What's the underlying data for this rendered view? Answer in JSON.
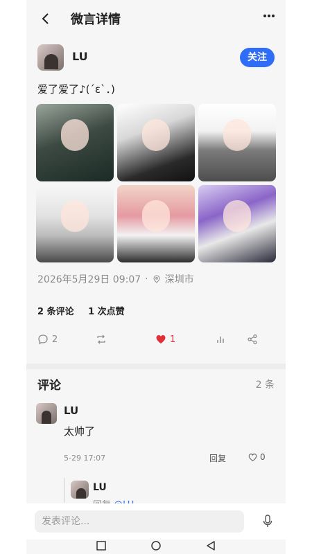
{
  "header": {
    "back_icon": "chevron-left",
    "title": "微言详情",
    "more_icon": "ellipsis"
  },
  "author": {
    "name": "LU",
    "follow_label": "关注"
  },
  "post": {
    "text": "爱了爱了♪(´ε`．)",
    "images": [
      "anime-boy-green-cloak",
      "anime-boy-violin",
      "anime-boy-gray-sweater",
      "anime-girl-school-uniform",
      "anime-girl-heart-pillow",
      "anime-girl-purple-hair"
    ],
    "datetime": "2026年5月29日 09:07",
    "dot": "·",
    "location": "深圳市"
  },
  "stats": {
    "comments": "2 条评论",
    "likes": "1 次点赞"
  },
  "actions": {
    "comment_count": "2",
    "like_count": "1",
    "like_color": "#e0313a"
  },
  "comments": {
    "heading": "评论",
    "count": "2 条",
    "items": [
      {
        "name": "LU",
        "text": "太帅了",
        "time": "5-29 17:07",
        "reply_label": "回复",
        "likes": "0"
      }
    ],
    "sub_reply": {
      "name": "LU",
      "prefix": "回复 ",
      "mention": "@LU"
    }
  },
  "input": {
    "placeholder": "发表评论..."
  },
  "colors": {
    "accent": "#2f6df6",
    "background": "#f6f6f6"
  }
}
